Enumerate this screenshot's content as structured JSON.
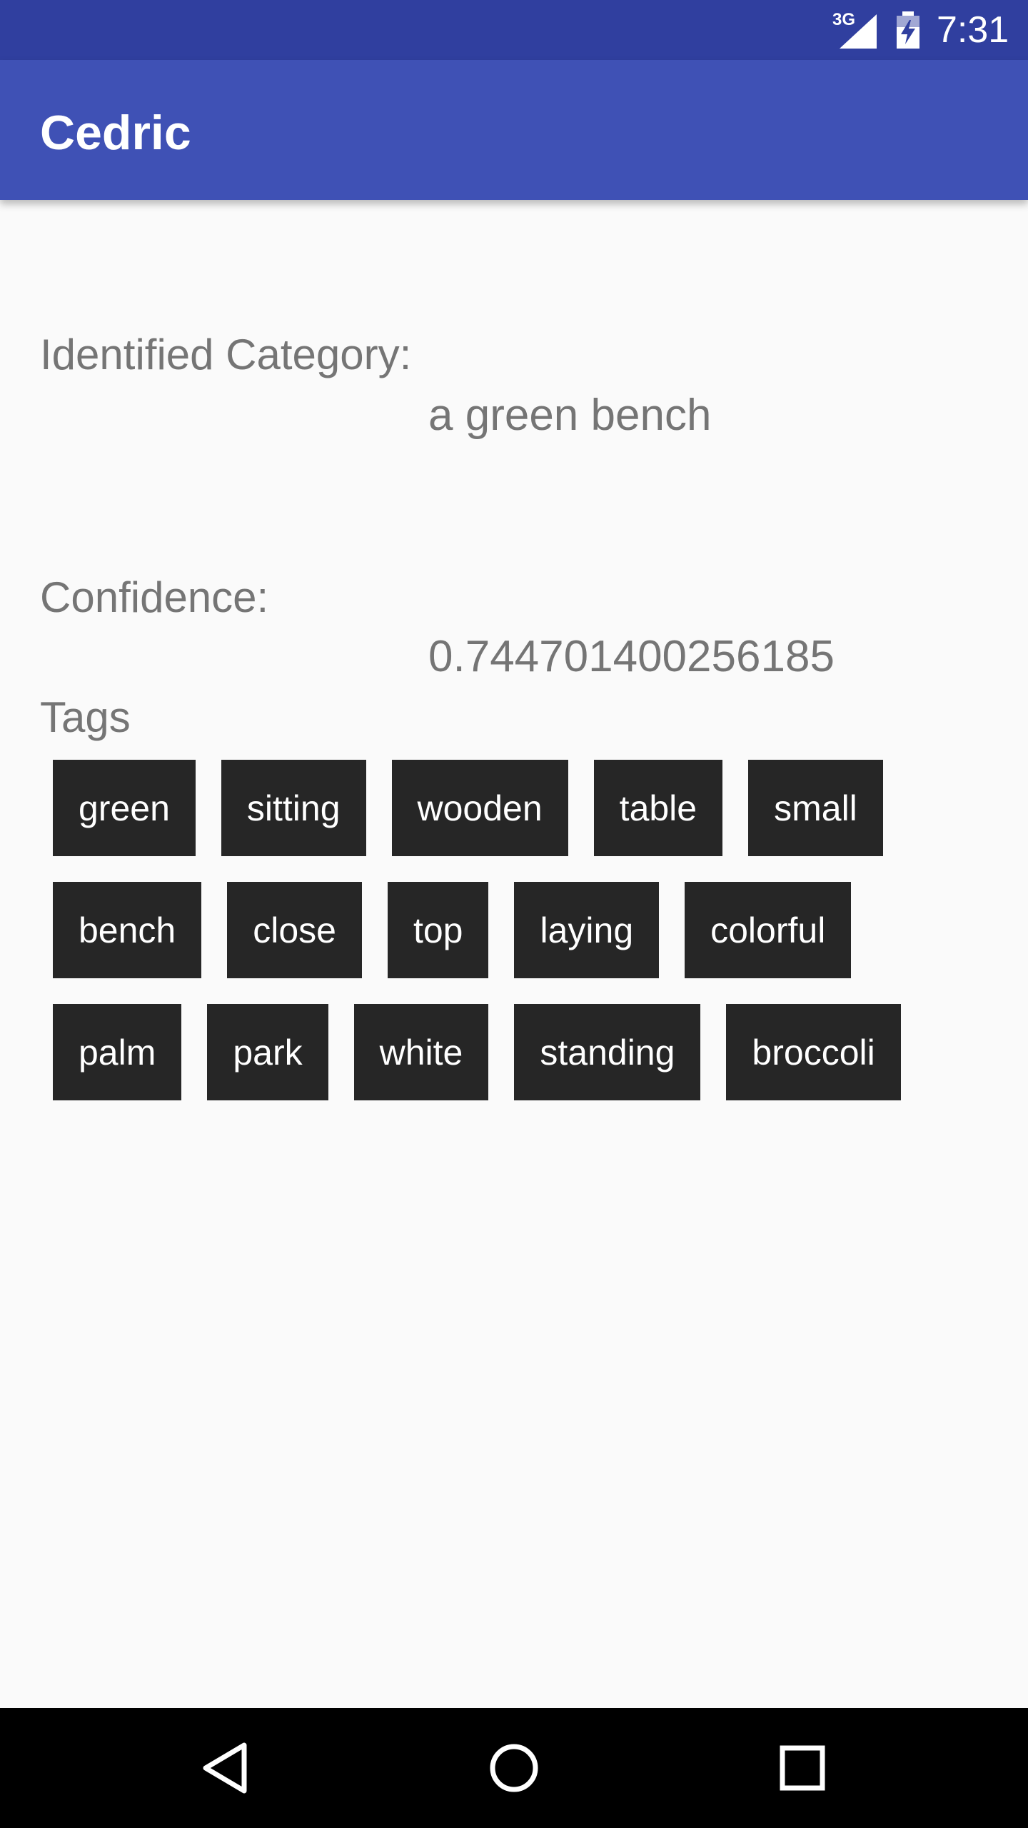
{
  "status_bar": {
    "network": "3G",
    "time": "7:31",
    "icons": [
      "signal-icon",
      "battery-charging-icon"
    ]
  },
  "app_bar": {
    "title": "Cedric",
    "color": "#3f51b5",
    "status_color": "#303f9f"
  },
  "result": {
    "category_label": "Identified Category:",
    "category_value": "a green bench",
    "confidence_label": "Confidence:",
    "confidence_value": "0.744701400256185",
    "tags_label": "Tags"
  },
  "tags": [
    [
      "green",
      "sitting",
      "wooden",
      "table",
      "small"
    ],
    [
      "bench",
      "close",
      "top",
      "laying",
      "colorful"
    ],
    [
      "palm",
      "park",
      "white",
      "standing",
      "broccoli"
    ]
  ],
  "nav_bar": {
    "icons": [
      "back-icon",
      "home-icon",
      "recents-icon"
    ]
  }
}
